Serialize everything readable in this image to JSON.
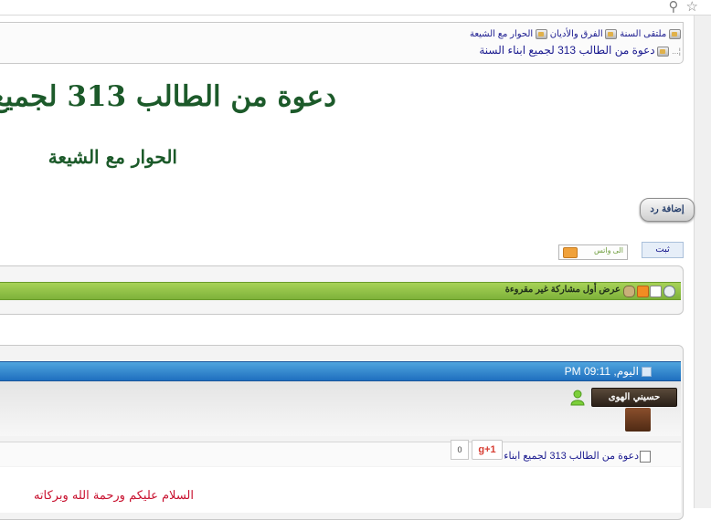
{
  "browser": {
    "icons": [
      "search-icon",
      "star-icon"
    ]
  },
  "breadcrumb": {
    "items": [
      {
        "label": "ملتقى السنة"
      },
      {
        "label": "الفرق والأديان"
      },
      {
        "label": "الحوار مع الشيعة"
      }
    ],
    "current": "دعوة من الطالب 313 لجميع ابناء السنة"
  },
  "thread": {
    "title": "دعوة من الطالب 313 لجميع",
    "forum_name": "الحوار مع الشيعة"
  },
  "actions": {
    "add_reply": "إضافة رد",
    "pin": "ثبت",
    "share_label": "الى واتس"
  },
  "toolbar": {
    "first_unread": "عرض أول مشاركة غير مقروءة",
    "icons": [
      "search-icon",
      "page-icon",
      "rss-icon",
      "tools-icon"
    ]
  },
  "post": {
    "date": "اليوم, 09:11 PM",
    "username": "حسيني الهوى",
    "title": "دعوة من الطالب 313 لجميع ابناء السنة",
    "gplus": "g+1",
    "count": "0",
    "greeting": "السلام عليكم ورحمة الله وبركاته"
  },
  "colors": {
    "title_green": "#1c5a2a",
    "link_blue": "#1a1a8f",
    "bar_green": "#8fc447",
    "bar_blue": "#2a7fcf",
    "greeting_red": "#c8102e"
  }
}
